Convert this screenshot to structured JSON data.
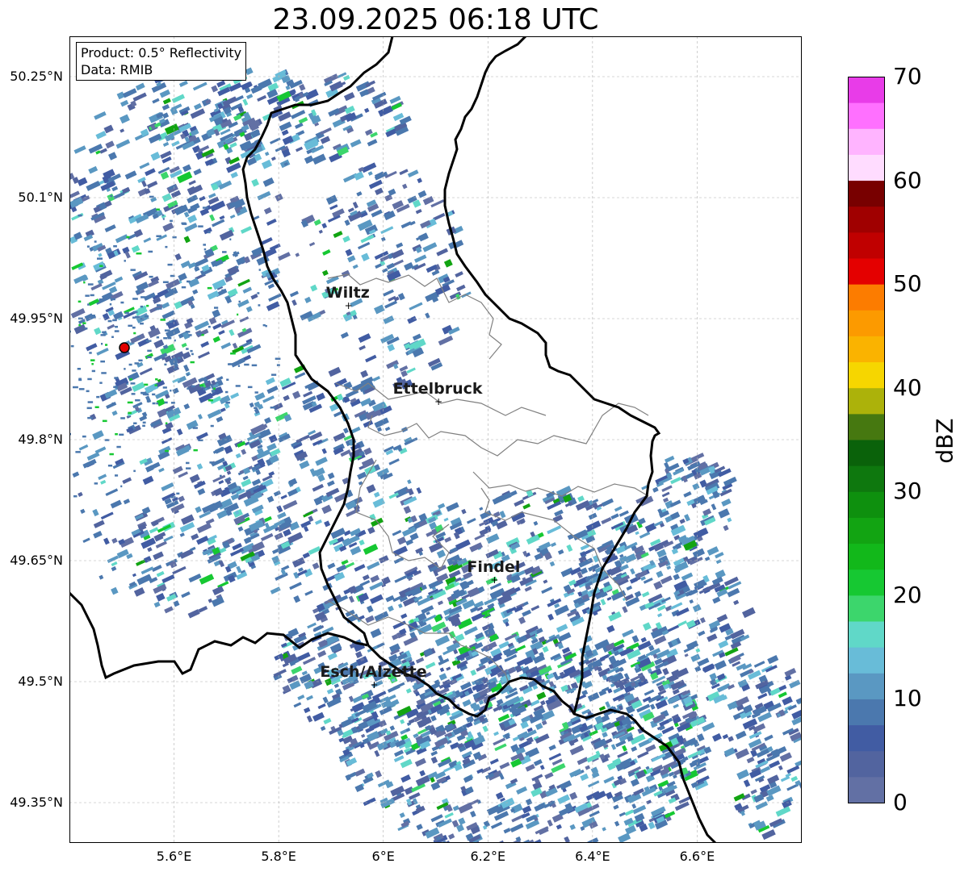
{
  "title": "23.09.2025 06:18 UTC",
  "info": {
    "product": "Product: 0.5° Reflectivity",
    "data": "Data: RMIB"
  },
  "map": {
    "extent": {
      "lon_min": 5.4,
      "lon_max": 6.8,
      "lat_min": 49.3,
      "lat_max": 50.3
    },
    "lat_ticks": [
      {
        "value": 50.25,
        "label": "50.25°N"
      },
      {
        "value": 50.1,
        "label": "50.1°N"
      },
      {
        "value": 49.95,
        "label": "49.95°N"
      },
      {
        "value": 49.8,
        "label": "49.8°N"
      },
      {
        "value": 49.65,
        "label": "49.65°N"
      },
      {
        "value": 49.5,
        "label": "49.5°N"
      },
      {
        "value": 49.35,
        "label": "49.35°N"
      }
    ],
    "lon_ticks": [
      {
        "value": 5.6,
        "label": "5.6°E"
      },
      {
        "value": 5.8,
        "label": "5.8°E"
      },
      {
        "value": 6.0,
        "label": "6°E"
      },
      {
        "value": 6.2,
        "label": "6.2°E"
      },
      {
        "value": 6.4,
        "label": "6.4°E"
      },
      {
        "value": 6.6,
        "label": "6.6°E"
      }
    ],
    "radar_site": {
      "lon": 5.505,
      "lat": 49.914
    },
    "cities": [
      {
        "name": "Wiltz",
        "lon": 5.932,
        "lat": 49.966
      },
      {
        "name": "Ettelbruck",
        "lon": 6.104,
        "lat": 49.847
      },
      {
        "name": "Findel",
        "lon": 6.211,
        "lat": 49.626
      },
      {
        "name": "Esch/Alzette",
        "lon": 5.981,
        "lat": 49.496
      }
    ],
    "border_color": "#000000",
    "canton_color": "#808080"
  },
  "colorbar": {
    "label": "dBZ",
    "min": 0,
    "max": 70,
    "ticks": [
      "0",
      "10",
      "20",
      "30",
      "40",
      "50",
      "60",
      "70"
    ],
    "colors": [
      "#6270a4",
      "#52649f",
      "#415ca3",
      "#4b78ae",
      "#5a98c2",
      "#68bcd8",
      "#60d8c8",
      "#3cd66c",
      "#16c832",
      "#12b81a",
      "#12a412",
      "#0e900e",
      "#0e780e",
      "#0a620a",
      "#467810",
      "#acb20a",
      "#f6d600",
      "#fab300",
      "#fc9a00",
      "#fc7c00",
      "#e40000",
      "#c00000",
      "#a00000",
      "#780000",
      "#ffdcff",
      "#ffb4ff",
      "#ff70ff",
      "#e83ce8"
    ]
  }
}
